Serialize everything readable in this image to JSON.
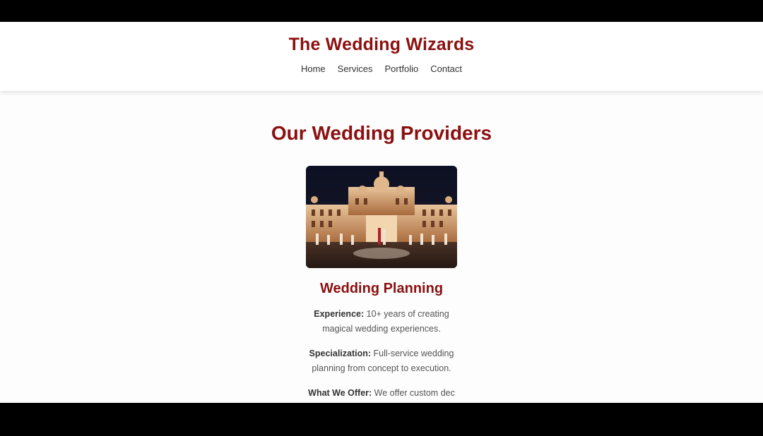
{
  "header": {
    "title": "The Wedding Wizards",
    "nav": [
      {
        "label": "Home"
      },
      {
        "label": "Services"
      },
      {
        "label": "Portfolio"
      },
      {
        "label": "Contact"
      }
    ]
  },
  "main": {
    "heading": "Our Wedding Providers",
    "card": {
      "title": "Wedding Planning",
      "details": [
        {
          "label": "Experience:",
          "text": "10+ years of creating magical wedding experiences."
        },
        {
          "label": "Specialization:",
          "text": "Full-service wedding planning from concept to execution."
        },
        {
          "label": "What We Offer:",
          "text": "We offer custom dec"
        }
      ]
    }
  },
  "colors": {
    "accent": "#8b1010",
    "page_background": "#fdfdfd"
  }
}
